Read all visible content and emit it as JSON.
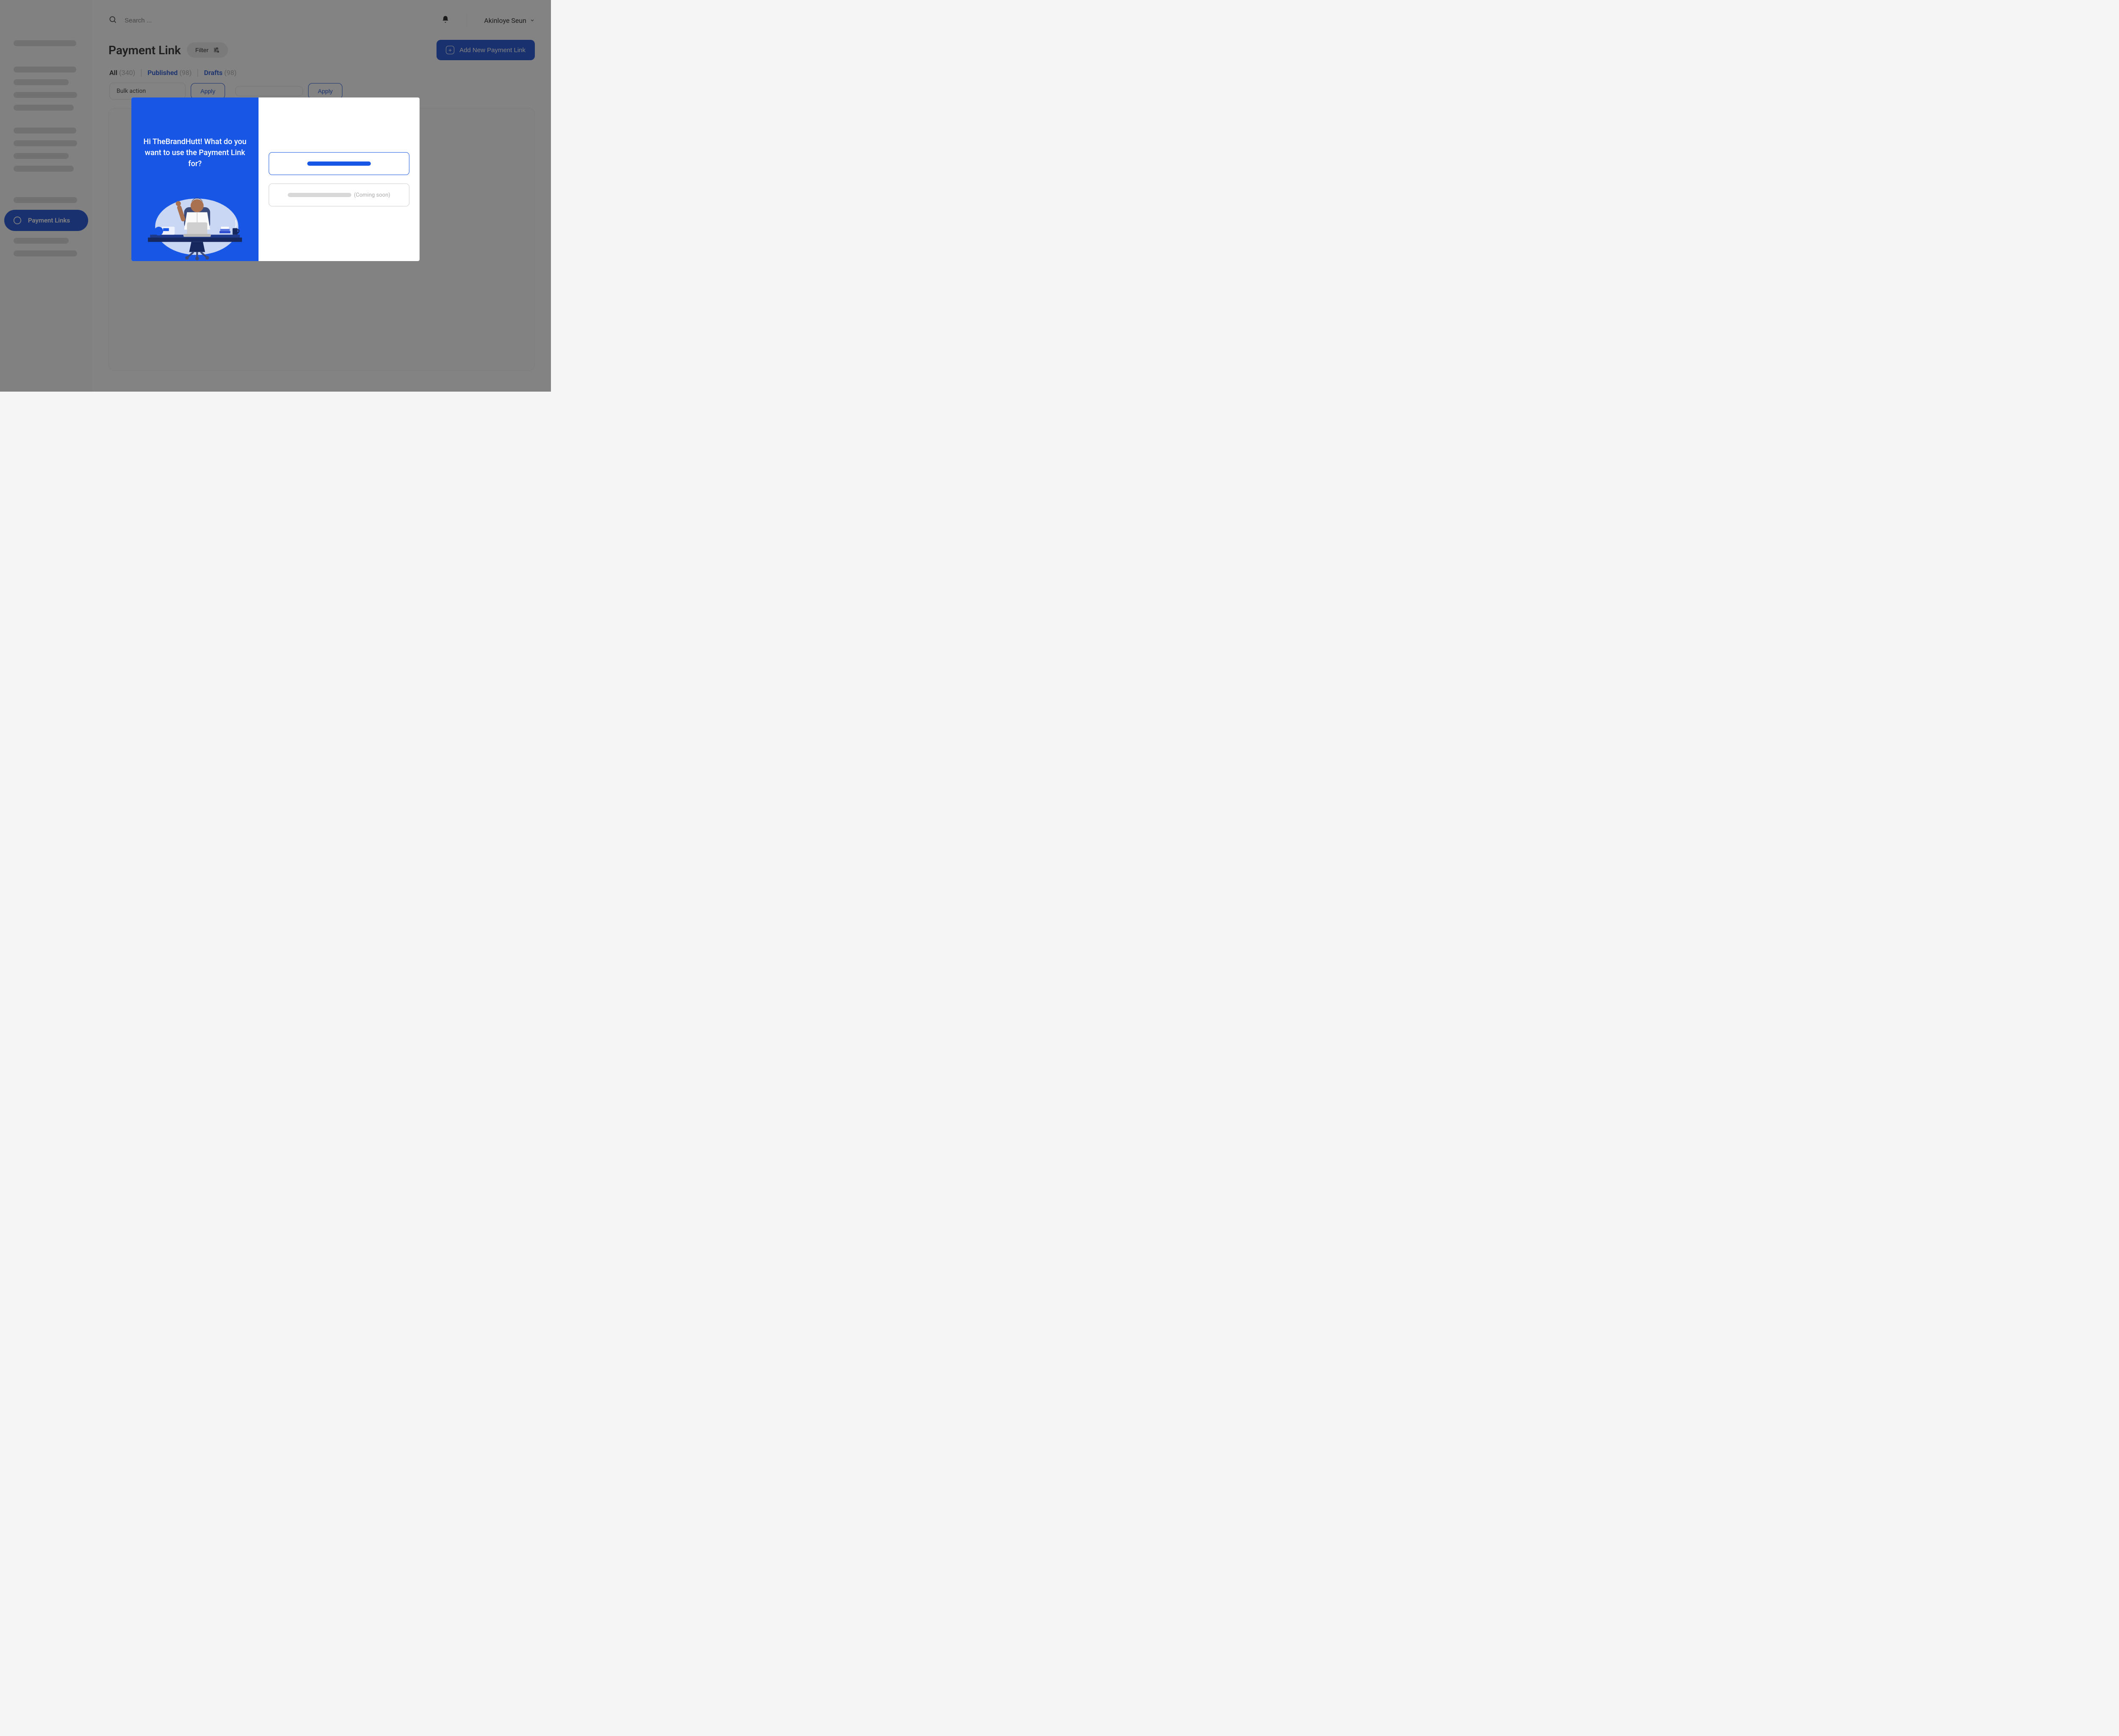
{
  "header": {
    "search_placeholder": "Search ...",
    "user_name": "Akinloye Seun"
  },
  "page": {
    "title": "Payment Link",
    "filter_label": "Filter",
    "add_button_label": "Add New Payment Link"
  },
  "tabs": {
    "all": {
      "label": "All",
      "count": "(340)"
    },
    "published": {
      "label": "Published",
      "count": "(98)"
    },
    "drafts": {
      "label": "Drafts",
      "count": "(98)"
    }
  },
  "controls": {
    "bulk_action_label": "Bulk action",
    "apply_label": "Apply"
  },
  "sidebar": {
    "active_item_label": "Payment Links"
  },
  "modal": {
    "greeting": "Hi TheBrandHutt! What do you want to use the Payment Link for?",
    "coming_soon_label": "(Coming soon)"
  }
}
